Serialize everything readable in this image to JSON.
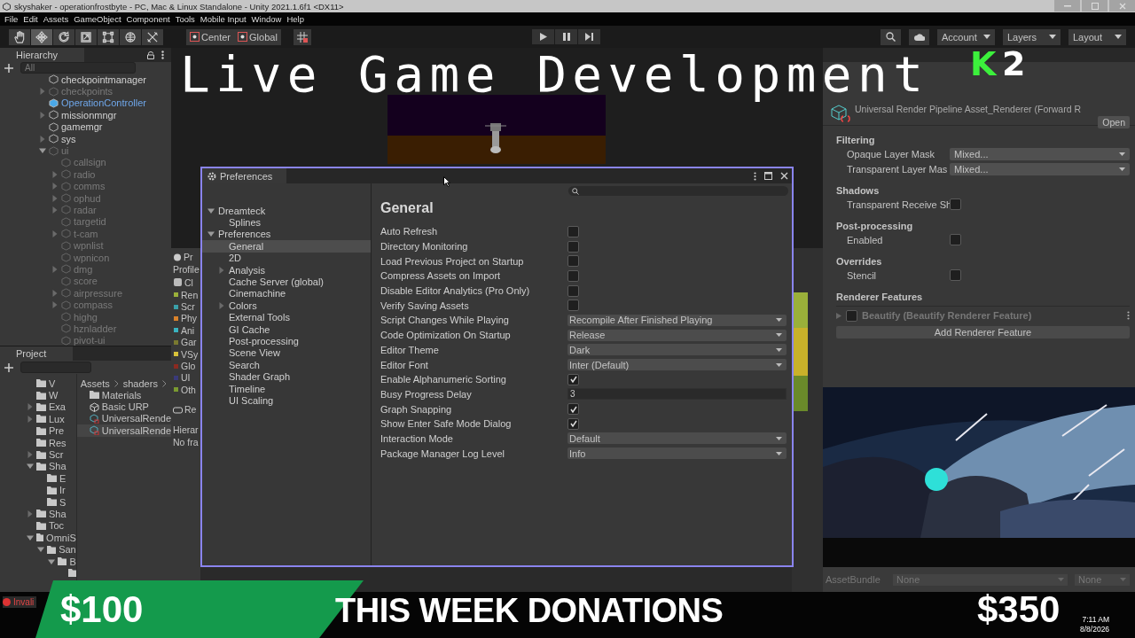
{
  "window": {
    "title": "skyshaker - operationfrostbyte - PC, Mac & Linux Standalone - Unity 2021.1.6f1 <DX11>"
  },
  "menu": [
    "File",
    "Edit",
    "Assets",
    "GameObject",
    "Component",
    "Tools",
    "Mobile Input",
    "Window",
    "Help"
  ],
  "toolbar": {
    "tools": [
      {
        "kind": "hand",
        "selected": false
      },
      {
        "kind": "move",
        "selected": true
      },
      {
        "kind": "rotate",
        "selected": false
      },
      {
        "kind": "scale",
        "selected": false
      },
      {
        "kind": "rect",
        "selected": false
      },
      {
        "kind": "transform",
        "selected": false
      },
      {
        "kind": "custom",
        "selected": false
      }
    ],
    "pivot": [
      "Center",
      "Global"
    ],
    "account": "Account",
    "layers": "Layers",
    "layout": "Layout"
  },
  "hierarchy": {
    "title": "Hierarchy",
    "placeholder": "All",
    "items": [
      {
        "name": "checkpointmanager",
        "arrow": false,
        "disabled": false,
        "prefab": false
      },
      {
        "name": "checkpoints",
        "arrow": true,
        "expanded": false,
        "disabled": true,
        "prefab": false
      },
      {
        "name": "OperationController",
        "arrow": false,
        "disabled": false,
        "prefab": true
      },
      {
        "name": "missionmngr",
        "arrow": true,
        "expanded": false,
        "disabled": false,
        "prefab": false
      },
      {
        "name": "gamemgr",
        "arrow": false,
        "disabled": false,
        "prefab": false
      },
      {
        "name": "sys",
        "arrow": true,
        "expanded": false,
        "disabled": false,
        "prefab": false
      },
      {
        "name": "ui",
        "arrow": true,
        "expanded": true,
        "disabled": true,
        "prefab": false,
        "children": [
          {
            "name": "callsign",
            "arrow": false,
            "disabled": true,
            "prefab": false
          },
          {
            "name": "radio",
            "arrow": true,
            "expanded": false,
            "disabled": true,
            "prefab": false
          },
          {
            "name": "comms",
            "arrow": true,
            "expanded": false,
            "disabled": true,
            "prefab": false
          },
          {
            "name": "ophud",
            "arrow": true,
            "expanded": false,
            "disabled": true,
            "prefab": false
          },
          {
            "name": "radar",
            "arrow": true,
            "expanded": false,
            "disabled": true,
            "prefab": false
          },
          {
            "name": "targetid",
            "arrow": false,
            "disabled": true,
            "prefab": false
          },
          {
            "name": "t-cam",
            "arrow": true,
            "expanded": false,
            "disabled": true,
            "prefab": false
          },
          {
            "name": "wpnlist",
            "arrow": false,
            "disabled": true,
            "prefab": false
          },
          {
            "name": "wpnicon",
            "arrow": false,
            "disabled": true,
            "prefab": false
          },
          {
            "name": "dmg",
            "arrow": true,
            "expanded": false,
            "disabled": true,
            "prefab": false
          },
          {
            "name": "score",
            "arrow": false,
            "disabled": true,
            "prefab": false
          },
          {
            "name": "airpressure",
            "arrow": true,
            "expanded": false,
            "disabled": true,
            "prefab": false
          },
          {
            "name": "compass",
            "arrow": true,
            "expanded": false,
            "disabled": true,
            "prefab": false
          },
          {
            "name": "highg",
            "arrow": false,
            "disabled": true,
            "prefab": false
          },
          {
            "name": "hznladder",
            "arrow": false,
            "disabled": true,
            "prefab": false
          },
          {
            "name": "pivot-ui",
            "arrow": false,
            "disabled": true,
            "prefab": false
          }
        ]
      }
    ]
  },
  "project": {
    "title": "Project",
    "tree": [
      {
        "name": "V",
        "arrow": false
      },
      {
        "name": "W",
        "arrow": false
      },
      {
        "name": "Exa",
        "arrow": true,
        "expanded": false
      },
      {
        "name": "Lux",
        "arrow": true,
        "expanded": false
      },
      {
        "name": "Pre",
        "arrow": false
      },
      {
        "name": "Res",
        "arrow": false
      },
      {
        "name": "Scr",
        "arrow": true,
        "expanded": false
      },
      {
        "name": "Sha",
        "arrow": true,
        "expanded": true,
        "children": [
          {
            "name": "E",
            "arrow": false
          },
          {
            "name": "Ir",
            "arrow": false
          },
          {
            "name": "S",
            "arrow": false
          }
        ]
      },
      {
        "name": "Sha",
        "arrow": true,
        "expanded": false
      },
      {
        "name": "Toc",
        "arrow": false
      },
      {
        "name": "OmniS",
        "arrow": true,
        "expanded": true,
        "children": [
          {
            "name": "San",
            "arrow": true,
            "expanded": true,
            "children": [
              {
                "name": "B",
                "arrow": true,
                "expanded": true,
                "children": [
                  {
                    "arrow": false
                  }
                ]
              }
            ]
          }
        ]
      }
    ],
    "breadcrumb": [
      "Assets",
      "shaders"
    ],
    "assets": [
      {
        "name": "Materials",
        "kind": "folder",
        "selected": false
      },
      {
        "name": "Basic URP",
        "kind": "unity",
        "selected": false
      },
      {
        "name": "UniversalRende",
        "kind": "asset",
        "selected": false
      },
      {
        "name": "UniversalRende",
        "kind": "asset",
        "selected": true
      }
    ]
  },
  "profiler": {
    "tab": "Pr",
    "label": "Profile",
    "module": "Cl",
    "categories": [
      {
        "name": "Ren",
        "color": "#9ab03a"
      },
      {
        "name": "Scr",
        "color": "#3aa0a8"
      },
      {
        "name": "Phy",
        "color": "#d9822b"
      },
      {
        "name": "Ani",
        "color": "#3ab3c0"
      },
      {
        "name": "Gar",
        "color": "#7a7a30"
      },
      {
        "name": "VSy",
        "color": "#d8c23a"
      },
      {
        "name": "Glo",
        "color": "#8a2a20"
      },
      {
        "name": "UI",
        "color": "#3a3a7a"
      },
      {
        "name": "Oth",
        "color": "#7a9a30"
      }
    ],
    "module_2": "Re",
    "hierarchy_label": "Hierar",
    "status": "No fra"
  },
  "game_view": {
    "kind": "picture"
  },
  "preferences": {
    "title": "Preferences",
    "tree": [
      {
        "name": "Dreamteck",
        "arrow": true,
        "expanded": true,
        "selected": false,
        "children": [
          {
            "name": "Splines",
            "arrow": false,
            "selected": false
          }
        ]
      },
      {
        "name": "Preferences",
        "arrow": true,
        "expanded": true,
        "selected": false,
        "children": [
          {
            "name": "General",
            "arrow": false,
            "selected": true
          },
          {
            "name": "2D",
            "arrow": false,
            "selected": false
          },
          {
            "name": "Analysis",
            "arrow": true,
            "expanded": false,
            "selected": false
          },
          {
            "name": "Cache Server (global)",
            "arrow": false,
            "selected": false
          },
          {
            "name": "Cinemachine",
            "arrow": false,
            "selected": false
          },
          {
            "name": "Colors",
            "arrow": true,
            "expanded": false,
            "selected": false
          },
          {
            "name": "External Tools",
            "arrow": false,
            "selected": false
          },
          {
            "name": "GI Cache",
            "arrow": false,
            "selected": false
          },
          {
            "name": "Post-processing",
            "arrow": false,
            "selected": false
          },
          {
            "name": "Scene View",
            "arrow": false,
            "selected": false
          },
          {
            "name": "Search",
            "arrow": false,
            "selected": false
          },
          {
            "name": "Shader Graph",
            "arrow": false,
            "selected": false
          },
          {
            "name": "Timeline",
            "arrow": false,
            "selected": false
          },
          {
            "name": "UI Scaling",
            "arrow": false,
            "selected": false
          }
        ]
      }
    ],
    "heading": "General",
    "settings": [
      {
        "label": "Auto Refresh",
        "kind": "checkbox",
        "checked": false
      },
      {
        "label": "Directory Monitoring",
        "kind": "checkbox",
        "checked": false
      },
      {
        "label": "Load Previous Project on Startup",
        "kind": "checkbox",
        "checked": false
      },
      {
        "label": "Compress Assets on Import",
        "kind": "checkbox",
        "checked": false
      },
      {
        "label": "Disable Editor Analytics (Pro Only)",
        "kind": "checkbox",
        "checked": false
      },
      {
        "label": "Verify Saving Assets",
        "kind": "checkbox",
        "checked": false
      },
      {
        "label": "Script Changes While Playing",
        "kind": "dropdown",
        "value": "Recompile After Finished Playing"
      },
      {
        "label": "Code Optimization On Startup",
        "kind": "dropdown",
        "value": "Release"
      },
      {
        "label": "Editor Theme",
        "kind": "dropdown",
        "value": "Dark"
      },
      {
        "label": "Editor Font",
        "kind": "dropdown",
        "value": "Inter (Default)"
      },
      {
        "label": "Enable Alphanumeric Sorting",
        "kind": "checkbox",
        "checked": true
      },
      {
        "label": "Busy Progress Delay",
        "kind": "text",
        "value": "3"
      },
      {
        "label": "Graph Snapping",
        "kind": "checkbox",
        "checked": true
      },
      {
        "label": "Show Enter Safe Mode Dialog",
        "kind": "checkbox",
        "checked": true
      },
      {
        "label": "Interaction Mode",
        "kind": "dropdown",
        "value": "Default"
      },
      {
        "label": "Package Manager Log Level",
        "kind": "dropdown",
        "value": "Info"
      }
    ]
  },
  "inspector": {
    "title": "Universal Render Pipeline Asset_Renderer (Forward R",
    "open_button": "Open",
    "sections": [
      {
        "heading": "Filtering",
        "rows": [
          {
            "label": "Opaque Layer Mask",
            "kind": "dropdown",
            "value": "Mixed..."
          },
          {
            "label": "Transparent Layer Mas",
            "kind": "dropdown",
            "value": "Mixed..."
          }
        ]
      },
      {
        "heading": "Shadows",
        "rows": [
          {
            "label": "Transparent Receive Sh",
            "kind": "checkbox",
            "checked": false
          }
        ]
      },
      {
        "heading": "Post-processing",
        "rows": [
          {
            "label": "Enabled",
            "kind": "checkbox",
            "checked": false
          }
        ]
      },
      {
        "heading": "Overrides",
        "rows": [
          {
            "label": "Stencil",
            "kind": "checkbox",
            "checked": false
          }
        ]
      }
    ],
    "features_heading": "Renderer Features",
    "features": [
      {
        "name": "Beautify (Beautify Renderer Feature)",
        "enabled": false
      }
    ],
    "add_button": "Add Renderer Feature"
  },
  "video": {
    "kind": "picture"
  },
  "asset_bundle": {
    "label": "AssetBundle",
    "values": [
      "None",
      "None"
    ]
  },
  "status_bar": {
    "message": "Invali"
  },
  "stream_overlay": {
    "title": "Live Game Development",
    "badge_letter": "K",
    "badge_number": "2",
    "donation_left": "$100",
    "caption": "THIS WEEK DONATIONS",
    "donation_right": "$350"
  },
  "clock": {
    "time": "7:11 AM",
    "date": "8/8/2026"
  }
}
